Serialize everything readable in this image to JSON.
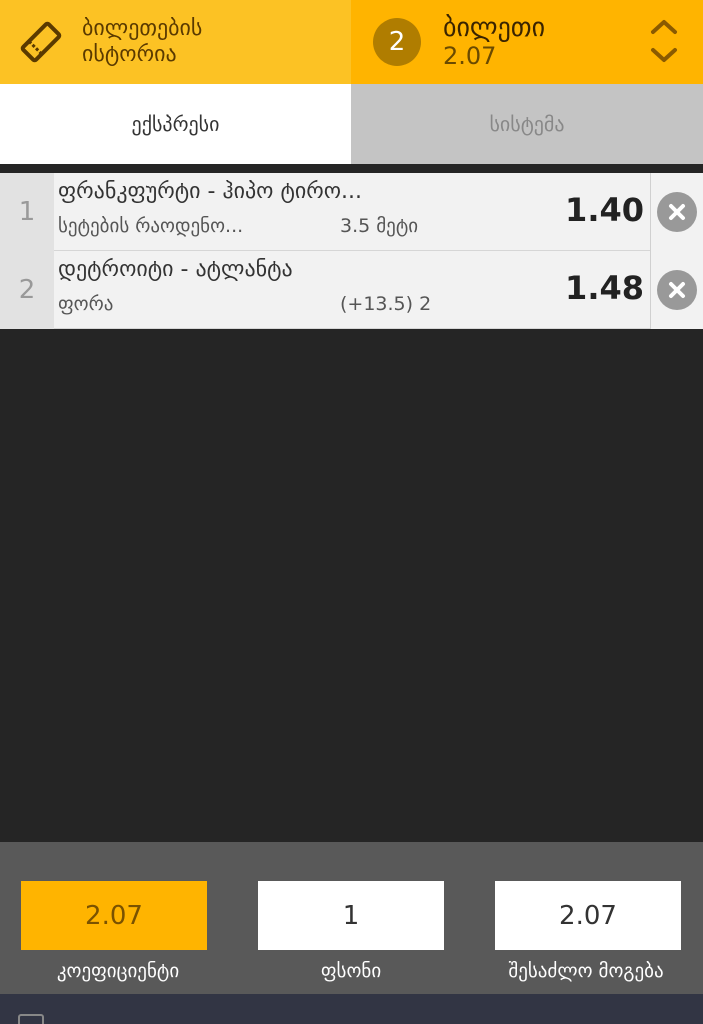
{
  "header": {
    "history_label": "ბილეთების ისტორია",
    "ticket_count": "2",
    "ticket_label": "ბილეთი",
    "ticket_odds": "2.07"
  },
  "tabs": [
    {
      "label": "ექსპრესი",
      "active": true
    },
    {
      "label": "სისტემა",
      "active": false
    }
  ],
  "bets": [
    {
      "index": "1",
      "event": "ფრანკფურტი - ჰიპო ტირო...",
      "market": "სეტების რაოდენო...",
      "selection": "3.5 მეტი",
      "odds": "1.40"
    },
    {
      "index": "2",
      "event": "დეტროიტი - ატლანტა",
      "market": "ფორა",
      "selection": "(+13.5) 2",
      "odds": "1.48"
    }
  ],
  "footer": {
    "coefficient_value": "2.07",
    "coefficient_label": "კოეფიციენტი",
    "stake_value": "1",
    "stake_label": "ფსონი",
    "win_value": "2.07",
    "win_label": "შესაძლო მოგება"
  },
  "colors": {
    "accent": "#ffb400",
    "accent_light": "#fcc224",
    "badge": "#b07d00"
  }
}
